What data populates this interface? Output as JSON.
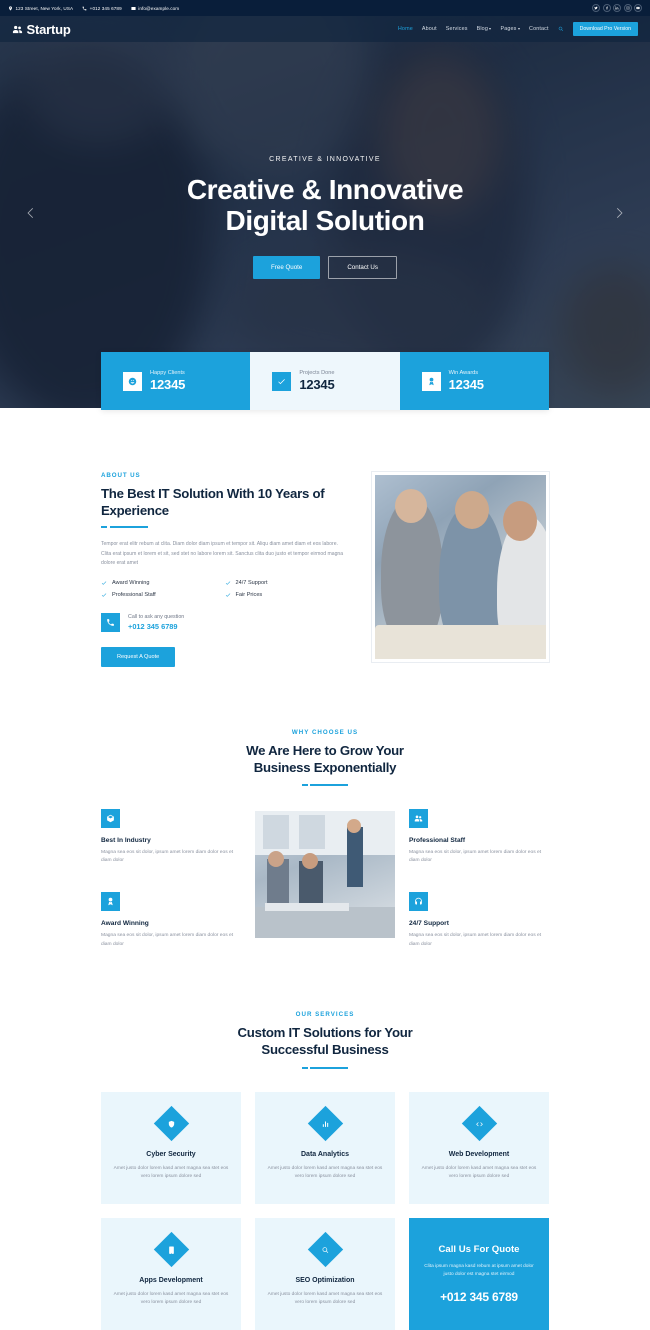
{
  "topbar": {
    "address": "123 Street, New York, USA",
    "phone": "+012 345 6789",
    "email": "info@example.com",
    "socials": [
      "twitter-icon",
      "facebook-icon",
      "linkedin-icon",
      "instagram-icon",
      "youtube-icon"
    ]
  },
  "navbar": {
    "brand": "Startup",
    "links": [
      {
        "label": "Home",
        "active": true,
        "dropdown": false
      },
      {
        "label": "About",
        "active": false,
        "dropdown": false
      },
      {
        "label": "Services",
        "active": false,
        "dropdown": false
      },
      {
        "label": "Blog",
        "active": false,
        "dropdown": true
      },
      {
        "label": "Pages",
        "active": false,
        "dropdown": true
      },
      {
        "label": "Contact",
        "active": false,
        "dropdown": false
      }
    ],
    "search_icon": "search-icon",
    "pro_button": "Download Pro Version"
  },
  "hero": {
    "kicker": "CREATIVE & INNOVATIVE",
    "title_line1": "Creative & Innovative",
    "title_line2": "Digital Solution",
    "btn_primary": "Free Quote",
    "btn_secondary": "Contact Us",
    "prev_icon": "chevron-left-icon",
    "next_icon": "chevron-right-icon"
  },
  "facts": [
    {
      "label": "Happy Clients",
      "value": "12345",
      "style": "blue",
      "icon": "smile-icon"
    },
    {
      "label": "Projects Done",
      "value": "12345",
      "style": "light",
      "icon": "check-icon"
    },
    {
      "label": "Win Awards",
      "value": "12345",
      "style": "blue",
      "icon": "award-icon"
    }
  ],
  "about": {
    "kicker": "ABOUT US",
    "title": "The Best IT Solution With 10 Years of Experience",
    "paragraph": "Tempor erat elitr rebum at clita. Diam dolor diam ipsum et tempor sit. Aliqu diam amet diam et eos labore. Clita erat ipsum et lorem et sit, sed stet no labore lorem sit. Sanctus clita duo justo et tempor eirmod magna dolore erat amet",
    "features": [
      "Award Winning",
      "24/7 Support",
      "Professional Staff",
      "Fair Prices"
    ],
    "call_label": "Call to ask any question",
    "call_number": "+012 345 6789",
    "button": "Request A Quote"
  },
  "why": {
    "kicker": "WHY CHOOSE US",
    "title_line1": "We Are Here to Grow Your",
    "title_line2": "Business Exponentially",
    "items_left": [
      {
        "title": "Best In Industry",
        "text": "Magna sea eos sit dolor, ipsum amet lorem diam dolor eos et diam dolor",
        "icon": "cubes-icon"
      },
      {
        "title": "Award Winning",
        "text": "Magna sea eos sit dolor, ipsum amet lorem diam dolor eos et diam dolor",
        "icon": "award-icon"
      }
    ],
    "items_right": [
      {
        "title": "Professional Staff",
        "text": "Magna sea eos sit dolor, ipsum amet lorem diam dolor eos et diam dolor",
        "icon": "users-icon"
      },
      {
        "title": "24/7 Support",
        "text": "Magna sea eos sit dolor, ipsum amet lorem diam dolor eos et diam dolor",
        "icon": "headset-icon"
      }
    ]
  },
  "services": {
    "kicker": "OUR SERVICES",
    "title_line1": "Custom IT Solutions for Your",
    "title_line2": "Successful Business",
    "cards": [
      {
        "title": "Cyber Security",
        "text": "Amet justo dolor lorem kasd amet magna sea stet eos vero lorem ipsum dolore sed",
        "icon": "shield-icon"
      },
      {
        "title": "Data Analytics",
        "text": "Amet justo dolor lorem kasd amet magna sea stet eos vero lorem ipsum dolore sed",
        "icon": "chart-icon"
      },
      {
        "title": "Web Development",
        "text": "Amet justo dolor lorem kasd amet magna sea stet eos vero lorem ipsum dolore sed",
        "icon": "code-icon"
      },
      {
        "title": "Apps Development",
        "text": "Amet justo dolor lorem kasd amet magna sea stet eos vero lorem ipsum dolore sed",
        "icon": "mobile-icon"
      },
      {
        "title": "SEO Optimization",
        "text": "Amet justo dolor lorem kasd amet magna sea stet eos vero lorem ipsum dolore sed",
        "icon": "search-icon"
      }
    ],
    "cta": {
      "title": "Call Us For Quote",
      "text": "Clita ipsum magna kasd rebum at ipsum amet dolor justo dolor est magna stet eirmod",
      "number": "+012 345 6789"
    }
  },
  "colors": {
    "accent": "#1CA2DC",
    "dark": "#091E3A",
    "heading": "#10263F",
    "muted": "#8A919F",
    "card_bg": "#EAF6FC"
  }
}
